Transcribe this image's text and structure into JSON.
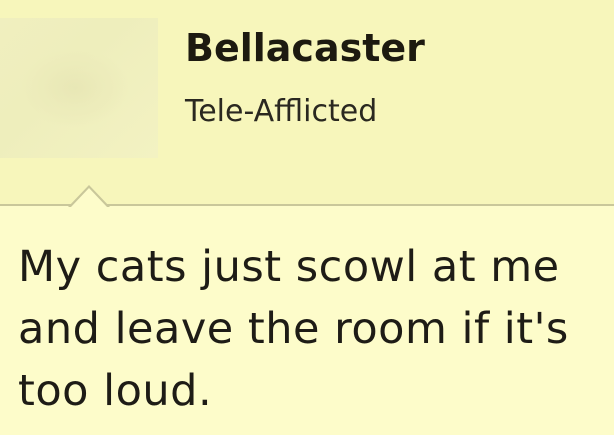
{
  "post": {
    "username": "Bellacaster",
    "user_title": "Tele-Afflicted",
    "message": "My cats just scowl at me and leave the room if it's too loud."
  },
  "colors": {
    "header_bg": "#f7f6bb",
    "body_bg": "#fdfcca",
    "divider": "#c9c79a",
    "text": "#1e1c16"
  }
}
